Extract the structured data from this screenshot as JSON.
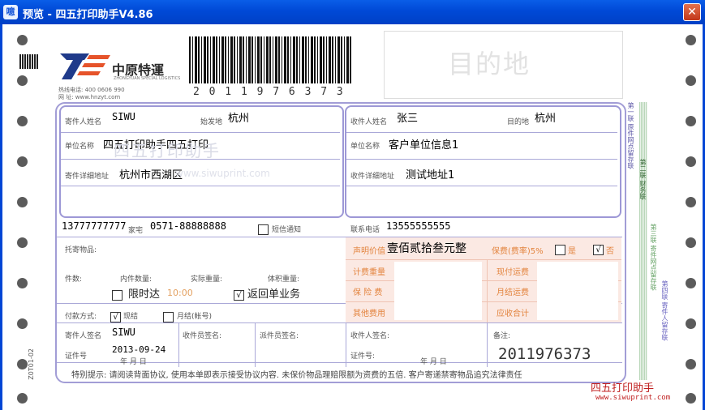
{
  "window": {
    "title": "预览 - 四五打印助手V4.86",
    "icon_text": "噫",
    "close_symbol": "✕"
  },
  "header": {
    "company_name": "中原特運",
    "company_sub": "ZHONGYUAN SPECIAL LOGISTICS",
    "phone_line": "热线电话: 400 0606 990",
    "web_line": "网  址: www.hnzyt.com",
    "barcode_number": "2 0 1 1 9 7 6 3 7 3",
    "destination_label": "目的地"
  },
  "sender": {
    "name_label": "寄件人姓名",
    "name": "SIWU",
    "origin_label": "始发地",
    "origin": "杭州",
    "company_label": "单位名称",
    "company": "四五打印助手四五打印",
    "address_label": "寄件详细地址",
    "address": "杭州市西湖区",
    "mobile": "13777777777",
    "phone_label": "家宅",
    "phone": "0571-88888888",
    "sms_label": "短信通知"
  },
  "receiver": {
    "name_label": "收件人姓名",
    "name": "张三",
    "dest_label": "目的地",
    "dest": "杭州",
    "company_label": "单位名称",
    "company": "客户单位信息1",
    "address_label": "收件详细地址",
    "address": "测试地址1",
    "phone_label": "联系电话",
    "phone": "13555555555"
  },
  "goods": {
    "item_label": "托寄物品:",
    "pieces_label": "件数:",
    "inner_label": "内件数量:",
    "actual_weight_label": "实际重量:",
    "volume_weight_label": "体积重量:",
    "timed_label": "限时达",
    "timed_time": "10:00",
    "return_label": "返回单业务",
    "return_checked": "√",
    "payment_label": "付款方式:",
    "cash_label": "现结",
    "cash_checked": "√",
    "monthly_label": "月结(帐号)"
  },
  "fees": {
    "declared_label": "声明价值",
    "declared_value": "壹佰贰拾叁元整",
    "insure_label": "保费(费率)5%",
    "yes_label": "是",
    "no_label": "否",
    "no_checked": "√",
    "rows_left": [
      "计费重量",
      "保 险 费",
      "其他费用"
    ],
    "rows_right": [
      "现付运费",
      "月结运费",
      "应收合计"
    ]
  },
  "signatures": {
    "sender_sign_label": "寄件人签名",
    "sender_sign": "SIWU",
    "id_label": "证件号",
    "date": "2013-09-24",
    "ymd": "年    月    日",
    "courier_label": "收件员签名:",
    "dispatch_label": "派件员签名:",
    "receiver_sign_label": "收件人签名:",
    "receiver_id_label": "证件号:",
    "remark_label": "备注:",
    "tracking_number": "2011976373"
  },
  "notice": "特别提示: 请阅读背面协议, 使用本单即表示接受协议内容. 未保价物品理赔限额为资费的五倍. 客户寄递禁寄物品追究法律责任",
  "side_labels": {
    "copy1": "第一联 原件网点留存联",
    "copy2": "第二联 财务联",
    "copy3": "第三联 寄件网点留存联",
    "copy4": "第四联 寄件人留存联"
  },
  "side_code": "Z0T01-02",
  "watermark": {
    "title": "四五打印助手",
    "url": "www.siwuprint.com"
  }
}
